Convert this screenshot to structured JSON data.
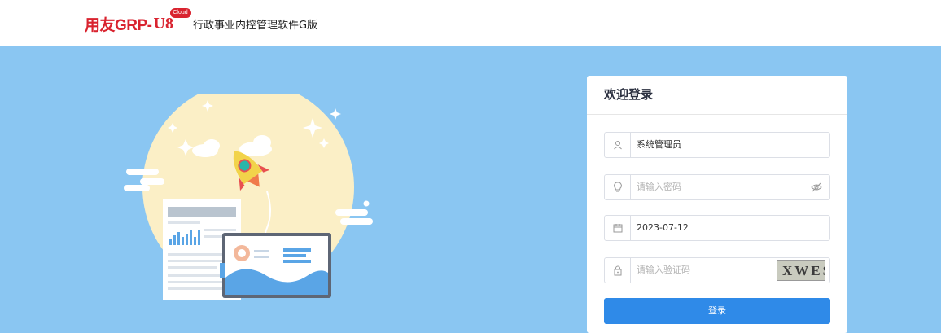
{
  "header": {
    "logo_text": "用友GRP-",
    "logo_us": "U8",
    "logo_cloud": "Cloud",
    "product_name": "行政事业内控管理软件G版"
  },
  "login": {
    "title": "欢迎登录",
    "username_value": "系统管理员",
    "password_placeholder": "请输入密码",
    "date_value": "2023-07-12",
    "captcha_placeholder": "请输入验证码",
    "captcha_text": "XWES",
    "login_label": "登录"
  },
  "colors": {
    "background": "#8ac6f2",
    "brand_red": "#d9232f",
    "button_blue": "#2f8ae8"
  },
  "icons": [
    "user-icon",
    "lightbulb-icon",
    "eye-off-icon",
    "calendar-icon",
    "lock-icon"
  ]
}
